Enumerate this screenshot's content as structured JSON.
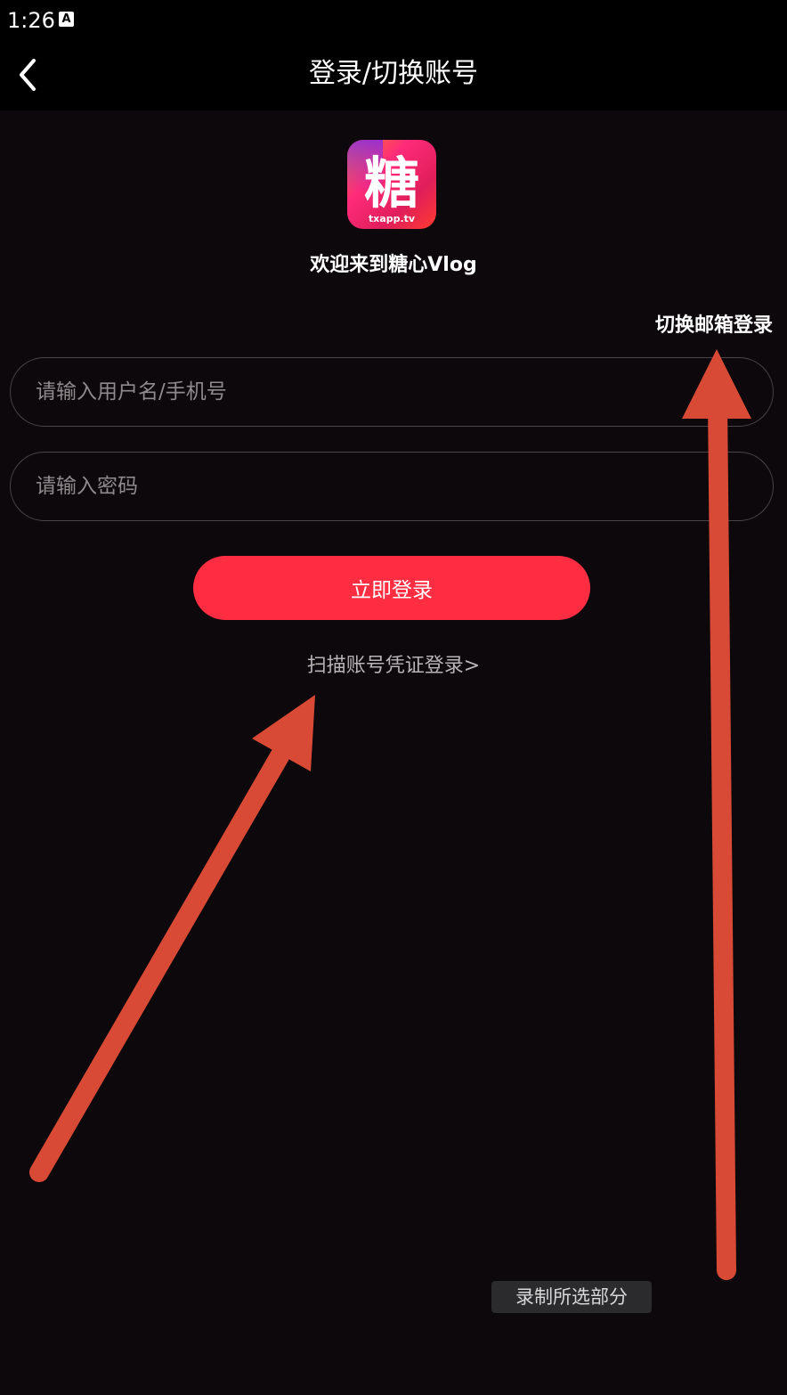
{
  "status_bar": {
    "time": "1:26",
    "app_icon_letter": "A"
  },
  "nav": {
    "title": "登录/切换账号",
    "back_icon": "chevron-left-icon"
  },
  "logo": {
    "char": "糖",
    "caption": "txapp.tv",
    "colors": [
      "#ff2d6f",
      "#a22bd8",
      "#ff8a1f"
    ]
  },
  "welcome": "欢迎来到糖心Vlog",
  "switch_email_label": "切换邮箱登录",
  "form": {
    "username_placeholder": "请输入用户名/手机号",
    "password_placeholder": "请输入密码",
    "login_label": "立即登录",
    "scan_label": "扫描账号凭证登录>"
  },
  "overlay": {
    "record_label": "录制所选部分",
    "arrow_color": "#d84a35"
  },
  "colors": {
    "background": "#0d080b",
    "accent": "#fe2d42"
  }
}
